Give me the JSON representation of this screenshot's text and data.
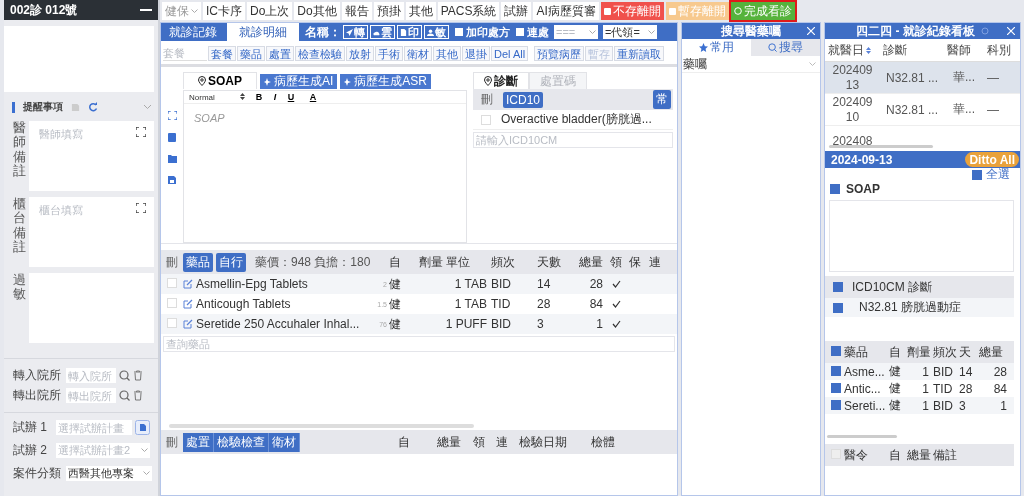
{
  "patient_panel": {
    "title": "002診 012號",
    "reminders": {
      "title": "提醒事項",
      "notes": [
        {
          "label": "醫師備註",
          "placeholder": "醫師填寫",
          "expandable": true
        },
        {
          "label": "櫃台備註",
          "placeholder": "櫃台填寫",
          "expandable": true
        },
        {
          "label": "過敏",
          "expandable": false
        }
      ]
    },
    "referrals": [
      {
        "label": "轉入院所",
        "placeholder": "轉入院所"
      },
      {
        "label": "轉出院所",
        "placeholder": "轉出院所"
      }
    ],
    "trials": [
      {
        "label": "試辦 1",
        "placeholder": "選擇試辦計畫",
        "kind": "button"
      },
      {
        "label": "試辦 2",
        "placeholder": "選擇試辦計畫2",
        "kind": "select"
      }
    ],
    "case_type": {
      "label": "案件分類",
      "value": "西醫其他專案"
    }
  },
  "toolbar": [
    {
      "label": "健保",
      "kind": "select",
      "outlined": false
    },
    {
      "label": "IC卡序",
      "kind": "plain",
      "outlined": false
    },
    {
      "label": "Do上次",
      "kind": "plain",
      "outlined": false
    },
    {
      "label": "Do其他",
      "kind": "plain",
      "outlined": false
    },
    {
      "label": "報告",
      "kind": "plain",
      "outlined": false
    },
    {
      "label": "預掛",
      "kind": "plain",
      "outlined": false
    },
    {
      "label": "其他",
      "kind": "plain",
      "outlined": false
    },
    {
      "label": "PACS系統",
      "kind": "plain",
      "outlined": false
    },
    {
      "label": "試辦",
      "kind": "plain",
      "outlined": false
    },
    {
      "label": "AI病歷質審",
      "kind": "plain",
      "outlined": false
    },
    {
      "label": "不存離開",
      "kind": "danger",
      "outlined": false
    },
    {
      "label": "暫存離開",
      "kind": "warning",
      "outlined": false
    },
    {
      "label": "完成看診",
      "kind": "success",
      "outlined": true
    }
  ],
  "visit_tabs": [
    {
      "label": "就診記錄",
      "selected": false
    },
    {
      "label": "就診明細",
      "selected": true
    }
  ],
  "name_label": "名稱：",
  "quick_buttons": [
    {
      "label": "轉",
      "kind": "send"
    },
    {
      "label": "雲",
      "kind": "cloud"
    },
    {
      "label": "印",
      "kind": "print"
    },
    {
      "label": "敏",
      "kind": "person"
    }
  ],
  "options": [
    {
      "label": "加印處方",
      "checked": false
    },
    {
      "label": "連處",
      "checked": false
    }
  ],
  "selects": [
    {
      "placeholder": "==="
    },
    {
      "value": "=代領="
    }
  ],
  "order_bar": {
    "placeholder": "套餐",
    "buttons": [
      "套餐",
      "藥品",
      "處置",
      "檢查檢驗",
      "放射",
      "手術",
      "衛材",
      "其他",
      "退掛",
      "Del All"
    ],
    "extra_buttons": [
      {
        "label": "預覽病歷",
        "disabled": false
      },
      {
        "label": "暫存",
        "disabled": true
      },
      {
        "label": "重新讀取",
        "disabled": false
      }
    ]
  },
  "soap": {
    "tab": "SOAP",
    "ai_buttons": [
      "病歷生成AI",
      "病歷生成ASR"
    ],
    "editor": {
      "format": "Normal",
      "tools": [
        "B",
        "I",
        "U",
        "A"
      ],
      "placeholder": "SOAP"
    }
  },
  "diagnosis": {
    "tabs": [
      {
        "label": "診斷",
        "selected": true
      },
      {
        "label": "處置碼",
        "selected": false
      }
    ],
    "delete_label": "刪",
    "code_label": "ICD10",
    "common_label": "常",
    "rows": [
      {
        "checked": false,
        "text": "Overactive bladder(膀胱過..."
      }
    ],
    "placeholder": "請輸入ICD10CM"
  },
  "medications": {
    "delete_label": "刪",
    "filters": [
      "藥品",
      "自行"
    ],
    "summary": "藥價：948 負擔：180",
    "columns": [
      "自",
      "劑量 單位",
      "頻次",
      "天數",
      "總量",
      "領",
      "保",
      "連"
    ],
    "rows": [
      {
        "checked": false,
        "name": "Asmellin-Epg Tablets",
        "note": "2",
        "payer": "健",
        "dose": "1 TAB",
        "freq": "BID",
        "days": "14",
        "total": "28",
        "dispensed": true
      },
      {
        "checked": false,
        "name": "Anticough Tablets",
        "note": "1.5",
        "payer": "健",
        "dose": "1 TAB",
        "freq": "TID",
        "days": "28",
        "total": "84",
        "dispensed": true
      },
      {
        "checked": false,
        "name": "Seretide 250 Accuhaler Inhal...",
        "note": "76",
        "payer": "健",
        "dose": "1 PUFF",
        "freq": "BID",
        "days": "3",
        "total": "1",
        "dispensed": true
      }
    ],
    "placeholder": "查詢藥品"
  },
  "procedures": {
    "delete_label": "刪",
    "filters": [
      "處置",
      "檢驗檢查",
      "衛材"
    ],
    "columns": [
      "自",
      "總量",
      "領",
      "連",
      "檢驗日期",
      "檢體"
    ]
  },
  "search_panel": {
    "title": "搜尋醫藥囑",
    "tabs": [
      {
        "label": "常用",
        "selected": true
      },
      {
        "label": "搜尋",
        "selected": false
      }
    ],
    "category": "藥囑"
  },
  "history_panel": {
    "title": "四二四 - 就診紀錄看板",
    "columns": [
      "就醫日",
      "診斷",
      "醫師",
      "科別"
    ],
    "rows": [
      {
        "date": "20240913",
        "diagnosis": "N32.81 ...",
        "doctor": "華...",
        "department": "—",
        "selected": true
      },
      {
        "date": "20240910",
        "diagnosis": "N32.81 ...",
        "doctor": "華...",
        "department": "—",
        "selected": false
      },
      {
        "date": "202408",
        "selected": false
      }
    ]
  },
  "record": {
    "date": "2024-09-13",
    "ditto": "Ditto All",
    "select_all": {
      "label": "全選",
      "checked": true
    },
    "soap": {
      "label": "SOAP",
      "checked": true
    },
    "diagnosis": {
      "label": "ICD10CM 診斷",
      "checked": true,
      "rows": [
        {
          "text": "N32.81 膀胱過動症",
          "checked": true
        }
      ]
    },
    "medications": {
      "checked": true,
      "columns": [
        "藥品",
        "自",
        "劑量",
        "頻次",
        "天",
        "總量"
      ],
      "rows": [
        {
          "checked": true,
          "cells": [
            "Asme...",
            "健",
            "1",
            "BID",
            "14",
            "28"
          ]
        },
        {
          "checked": true,
          "cells": [
            "Antic...",
            "健",
            "1",
            "TID",
            "28",
            "84"
          ]
        },
        {
          "checked": true,
          "cells": [
            "Sereti...",
            "健",
            "1",
            "BID",
            "3",
            "1"
          ]
        }
      ]
    },
    "orders": {
      "checked": false,
      "columns": [
        "醫令",
        "自",
        "總量",
        "備註"
      ]
    }
  }
}
